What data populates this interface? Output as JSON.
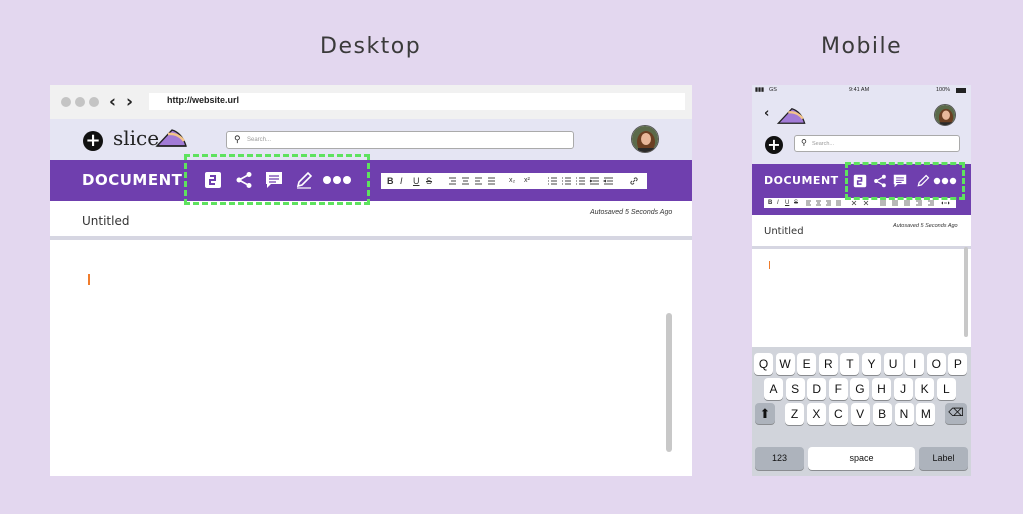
{
  "headings": {
    "desktop": "Desktop",
    "mobile": "Mobile"
  },
  "desktop": {
    "url": "http://website.url",
    "logo": "slice",
    "search_placeholder": "Search...",
    "doc_title": "DOCUMENT",
    "doc_name": "Untitled",
    "autosave": "Autosaved 5 Seconds Ago",
    "format": [
      "B",
      "I",
      "U",
      "S",
      "x₂",
      "x²"
    ]
  },
  "mobile": {
    "carrier": "GS",
    "time": "9:41 AM",
    "battery": "100%",
    "search_placeholder": "Search...",
    "doc_title": "DOCUMENT",
    "doc_name": "Untitled",
    "autosave": "Autosaved 5 Seconds Ago",
    "format": [
      "B",
      "I",
      "U",
      "S"
    ],
    "keys_row1": [
      "Q",
      "W",
      "E",
      "R",
      "T",
      "Y",
      "U",
      "I",
      "O",
      "P"
    ],
    "keys_row2": [
      "A",
      "S",
      "D",
      "F",
      "G",
      "H",
      "J",
      "K",
      "L"
    ],
    "keys_row3": [
      "Z",
      "X",
      "C",
      "V",
      "B",
      "N",
      "M"
    ],
    "key_numbers": "123",
    "key_space": "space",
    "key_label": "Label"
  },
  "colors": {
    "purple": "#6f3fae",
    "highlight": "#5ee25e",
    "background": "#e3d7ef",
    "cursor": "#f07c2c"
  }
}
